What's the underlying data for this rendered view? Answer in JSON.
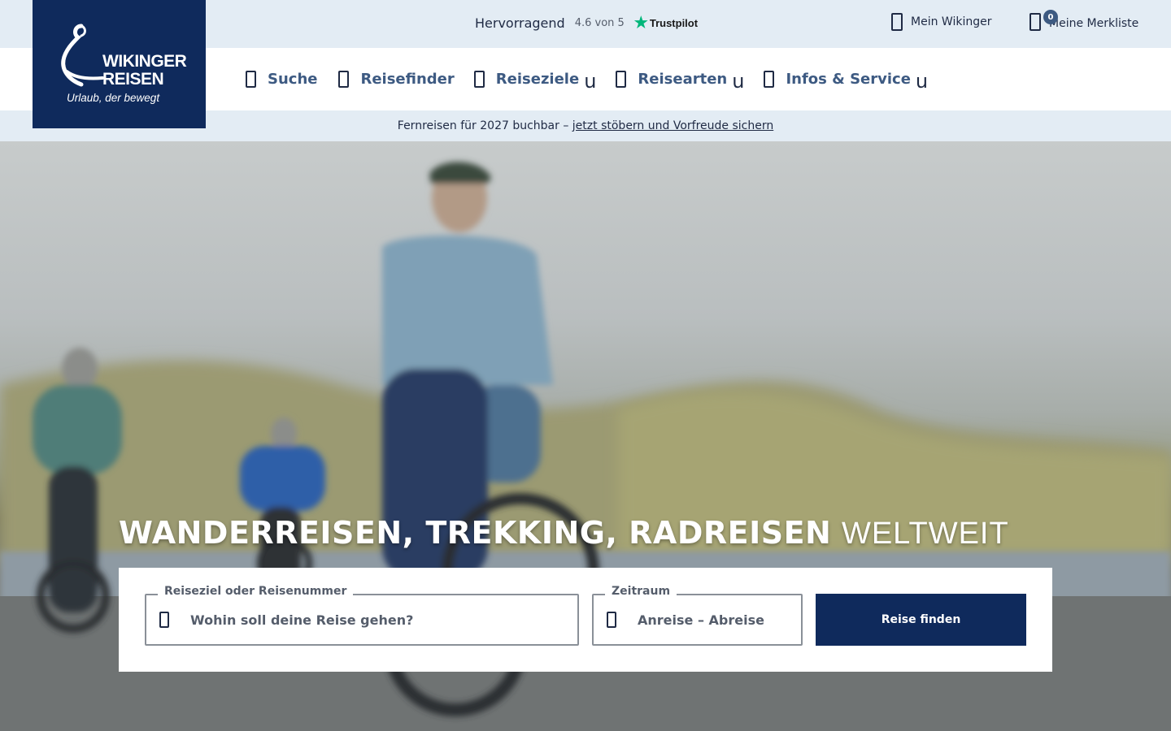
{
  "topbar": {
    "rating_label": "Hervorragend",
    "rating_score": "4.6 von 5",
    "rating_source": "Trustpilot",
    "account_label": "Mein Wikinger",
    "wishlist_label": "Meine Merkliste",
    "wishlist_count": "0"
  },
  "logo": {
    "brand_line1": "WIKINGER",
    "brand_line2": "REISEN",
    "tagline": "Urlaub, der bewegt"
  },
  "nav": {
    "items": [
      {
        "label": "Suche",
        "has_dropdown": false
      },
      {
        "label": "Reisefinder",
        "has_dropdown": false
      },
      {
        "label": "Reiseziele",
        "has_dropdown": true
      },
      {
        "label": "Reisearten",
        "has_dropdown": true
      },
      {
        "label": "Infos & Service",
        "has_dropdown": true
      }
    ],
    "caret_glyph": "u"
  },
  "promo": {
    "text": "Fernreisen für 2027 buchbar –",
    "link": "jetzt stöbern und Vorfreude sichern"
  },
  "hero": {
    "headline_bold": "WANDERREISEN, TREKKING, RADREISEN",
    "headline_thin": "WELTWEIT"
  },
  "search": {
    "destination_label": "Reiseziel oder Reisenummer",
    "destination_placeholder": "Wohin soll deine Reise gehen?",
    "period_label": "Zeitraum",
    "period_placeholder": "Anreise – Abreise",
    "submit_label": "Reise finden"
  },
  "colors": {
    "brand_navy": "#0f2a5c",
    "topbar_bg": "#e3ecf4",
    "nav_text": "#3d5a82",
    "trustpilot_green": "#00b67a"
  }
}
